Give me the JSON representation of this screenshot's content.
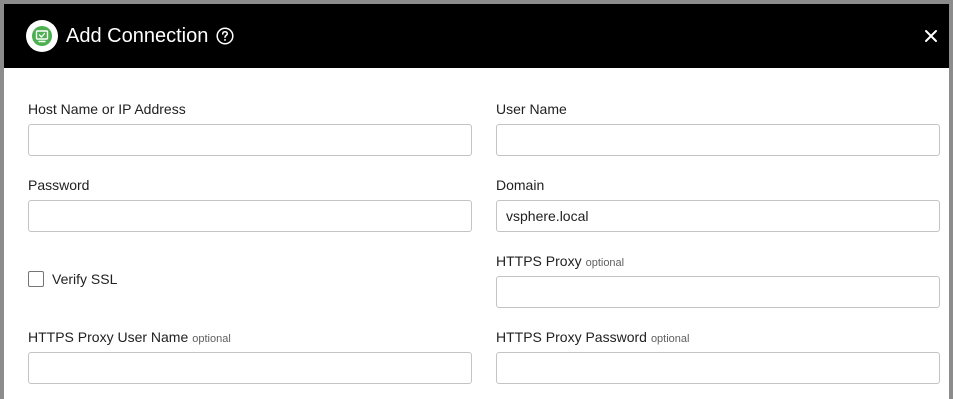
{
  "dialog": {
    "title": "Add Connection",
    "logo_icon": "vsphere-logo-icon",
    "help_icon": "help-circle-icon",
    "close_icon": "close-icon",
    "accent_color": "#4caf50"
  },
  "form": {
    "host": {
      "label": "Host Name or IP Address",
      "value": "",
      "placeholder": ""
    },
    "username": {
      "label": "User Name",
      "value": "",
      "placeholder": ""
    },
    "password": {
      "label": "Password",
      "value": "",
      "placeholder": ""
    },
    "domain": {
      "label": "Domain",
      "value": "vsphere.local",
      "placeholder": ""
    },
    "verify_ssl": {
      "label": "Verify SSL",
      "checked": false
    },
    "https_proxy": {
      "label": "HTTPS Proxy",
      "optional": "optional",
      "value": "",
      "placeholder": ""
    },
    "proxy_username": {
      "label": "HTTPS Proxy User Name",
      "optional": "optional",
      "value": "",
      "placeholder": ""
    },
    "proxy_password": {
      "label": "HTTPS Proxy Password",
      "optional": "optional",
      "value": "",
      "placeholder": ""
    }
  }
}
